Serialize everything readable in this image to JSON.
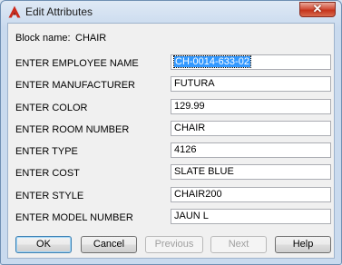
{
  "window": {
    "title": "Edit Attributes",
    "close_glyph": "✕"
  },
  "block": {
    "label": "Block name:",
    "value": "CHAIR"
  },
  "attributes": [
    {
      "label": "ENTER EMPLOYEE NAME",
      "value": "CH-0014-633-02"
    },
    {
      "label": "ENTER MANUFACTURER",
      "value": "FUTURA"
    },
    {
      "label": "ENTER COLOR",
      "value": "129.99"
    },
    {
      "label": "ENTER ROOM NUMBER",
      "value": "CHAIR"
    },
    {
      "label": "ENTER TYPE",
      "value": "4126"
    },
    {
      "label": "ENTER COST",
      "value": "SLATE BLUE"
    },
    {
      "label": "ENTER STYLE",
      "value": "CHAIR200"
    },
    {
      "label": "ENTER MODEL NUMBER",
      "value": "JAUN L"
    }
  ],
  "buttons": {
    "ok": "OK",
    "cancel": "Cancel",
    "previous": "Previous",
    "next": "Next",
    "help": "Help"
  },
  "colors": {
    "accent": "#3399ff",
    "close": "#c5341c",
    "app_icon": "#cc2a1c"
  },
  "icons": {
    "app": "autocad-logo-icon",
    "close": "close-icon"
  }
}
